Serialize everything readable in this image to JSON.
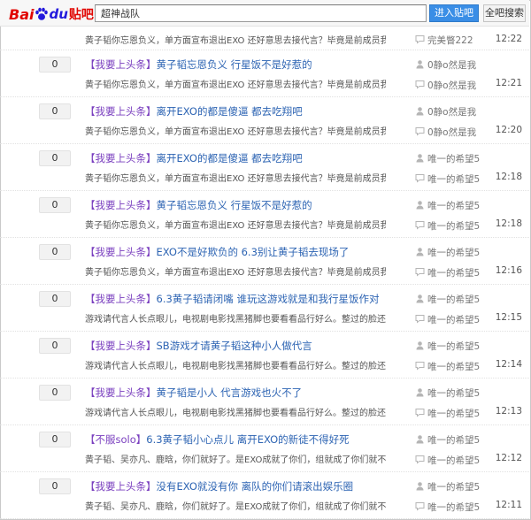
{
  "header": {
    "logo": {
      "bai": "Bai",
      "du": "du",
      "tieba": "贴吧"
    },
    "search_value": "超神战队",
    "enter_button": "进入贴吧",
    "all_button": "全吧搜索"
  },
  "first_row": {
    "abstract": "黄子韬你忘恩负义，单方面宣布退出EXO 还好意思去接代言？毕竟是前成员我们祝...",
    "last_reply": "完美瞥222",
    "time": "12:22"
  },
  "threads": [
    {
      "replies": "0",
      "tag": "【我要上头条】",
      "title": "黄子韬忘恩负义 行星饭不是好惹的",
      "abstract": "黄子韬你忘恩负义，单方面宣布退出EXO 还好意思去接代言？毕竟是前成员我们祝...",
      "author": "0静o然是我",
      "last_reply": "0静o然是我",
      "time": "12:21"
    },
    {
      "replies": "0",
      "tag": "【我要上头条】",
      "title": "离开EXO的都是傻逼 都去吃翔吧",
      "abstract": "黄子韬你忘恩负义，单方面宣布退出EXO 还好意思去接代言？毕竟是前成员我们祝...",
      "author": "0静o然是我",
      "last_reply": "0静o然是我",
      "time": "12:20"
    },
    {
      "replies": "0",
      "tag": "【我要上头条】",
      "title": "离开EXO的都是傻逼 都去吃翔吧",
      "abstract": "黄子韬你忘恩负义，单方面宣布退出EXO 还好意思去接代言？毕竟是前成员我们祝...",
      "author": "唯一的希望5",
      "last_reply": "唯一的希望5",
      "time": "12:18"
    },
    {
      "replies": "0",
      "tag": "【我要上头条】",
      "title": "黄子韬忘恩负义 行星饭不是好惹的",
      "abstract": "黄子韬你忘恩负义，单方面宣布退出EXO 还好意思去接代言？毕竟是前成员我们祝...",
      "author": "唯一的希望5",
      "last_reply": "唯一的希望5",
      "time": "12:18"
    },
    {
      "replies": "0",
      "tag": "【我要上头条】",
      "title": "EXO不是好欺负的 6.3别让黄子韬去现场了",
      "abstract": "黄子韬你忘恩负义，单方面宣布退出EXO 还好意思去接代言？毕竟是前成员我们祝...",
      "author": "唯一的希望5",
      "last_reply": "唯一的希望5",
      "time": "12:16"
    },
    {
      "replies": "0",
      "tag": "【我要上头条】",
      "title": "6.3黄子韬请闭嘴 谁玩这游戏就是和我行星饭作对",
      "abstract": "游戏请代言人长点眼儿，电视剧电影找黑猪脚也要看看品行好么。整过的脸还好意...",
      "author": "唯一的希望5",
      "last_reply": "唯一的希望5",
      "time": "12:15"
    },
    {
      "replies": "0",
      "tag": "【我要上头条】",
      "title": "SB游戏才请黄子韬这种小人做代言",
      "abstract": "游戏请代言人长点眼儿，电视剧电影找黑猪脚也要看看品行好么。整过的脸还好意...",
      "author": "唯一的希望5",
      "last_reply": "唯一的希望5",
      "time": "12:14"
    },
    {
      "replies": "0",
      "tag": "【我要上头条】",
      "title": "黄子韬是小人 代言游戏也火不了",
      "abstract": "游戏请代言人长点眼儿，电视剧电影找黑猪脚也要看看品行好么。整过的脸还好意...",
      "author": "唯一的希望5",
      "last_reply": "唯一的希望5",
      "time": "12:13"
    },
    {
      "replies": "0",
      "tag": "【不服solo】",
      "title": "6.3黄子韬小心点儿 离开EXO的新徒不得好死",
      "abstract": "黄子韬、吴亦凡、鹿晗，你们就好了。是EXO成就了你们，组就成了你们就不稀罕...",
      "author": "唯一的希望5",
      "last_reply": "唯一的希望5",
      "time": "12:12"
    },
    {
      "replies": "0",
      "tag": "【我要上头条】",
      "title": "没有EXO就没有你 离队的你们请滚出娱乐圈",
      "abstract": "黄子韬、吴亦凡、鹿晗，你们就好了。是EXO成就了你们，组就成了你们就不稀罕...",
      "author": "唯一的希望5",
      "last_reply": "唯一的希望5",
      "time": "12:11"
    }
  ],
  "icons": {
    "search": "paw-logo-icon",
    "author": "user-icon",
    "last_reply": "speech-bubble-icon"
  },
  "colors": {
    "logo_red": "#e10602",
    "logo_blue": "#2319dc",
    "tag_purple": "#7a3fbf",
    "title_blue": "#2d64b3",
    "enter_button": "#3a8ee6"
  }
}
